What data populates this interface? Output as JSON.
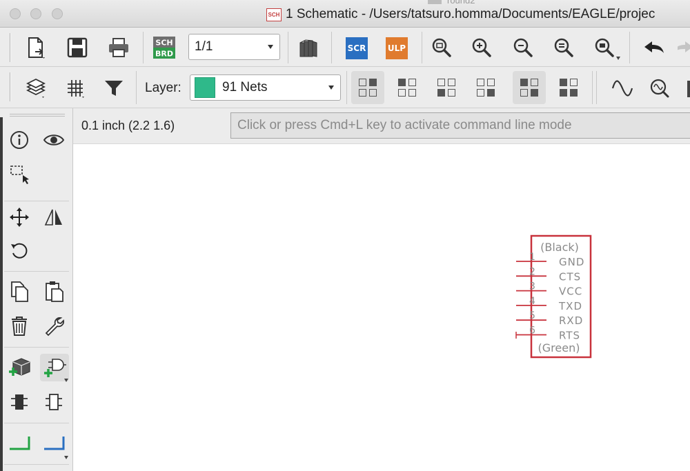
{
  "window": {
    "title": "1 Schematic - /Users/tatsuro.homma/Documents/EAGLE/projec",
    "title_icon": "SCH",
    "background_tab": "round2"
  },
  "toolbar1": {
    "sheet_select": "1/1",
    "sch_brd_label_top": "SCH",
    "sch_brd_label_bottom": "BRD",
    "scr_label": "SCR",
    "ulp_label": "ULP",
    "scr_color": "#2a6fc1",
    "ulp_color": "#e07b2e"
  },
  "toolbar2": {
    "layer_label": "Layer:",
    "layer_value": "91 Nets",
    "layer_color": "#2fb98a"
  },
  "status": {
    "coords": "0.1 inch (2.2 1.6)",
    "command_placeholder": "Click or press Cmd+L key to activate command line mode"
  },
  "schematic": {
    "outline_color": "#c8323c",
    "top_label": "(Black)",
    "bottom_label": "(Green)",
    "pins": [
      {
        "num": "1",
        "name": "GND"
      },
      {
        "num": "2",
        "name": "CTS"
      },
      {
        "num": "3",
        "name": "VCC"
      },
      {
        "num": "4",
        "name": "TXD"
      },
      {
        "num": "5",
        "name": "RXD"
      },
      {
        "num": "6",
        "name": "RTS"
      }
    ]
  },
  "icons": {
    "file": "new-file-icon",
    "save": "save-icon",
    "print": "print-icon",
    "library": "library-icon",
    "zoom_fit": "zoom-fit-icon",
    "zoom_in": "zoom-in-icon",
    "zoom_out": "zoom-out-icon",
    "zoom_redraw": "zoom-redraw-icon",
    "zoom_select": "zoom-select-icon",
    "undo": "undo-icon"
  }
}
